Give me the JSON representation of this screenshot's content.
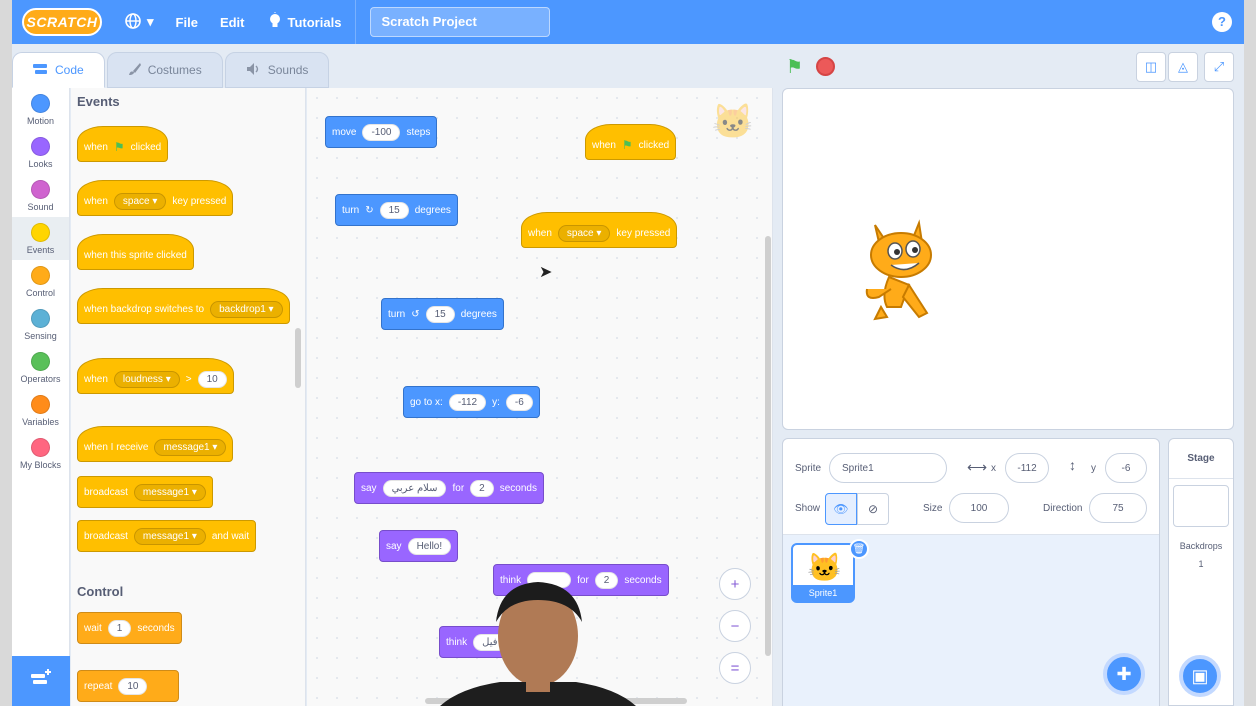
{
  "menubar": {
    "logo": "SCRATCH",
    "globe": "▾",
    "file": "File",
    "edit": "Edit",
    "tutorials": "Tutorials",
    "project_title": "Scratch Project",
    "help": "?"
  },
  "tabs": {
    "code": "Code",
    "costumes": "Costumes",
    "sounds": "Sounds"
  },
  "categories": [
    {
      "label": "Motion",
      "color": "#4c97ff"
    },
    {
      "label": "Looks",
      "color": "#9966ff"
    },
    {
      "label": "Sound",
      "color": "#cf63cf"
    },
    {
      "label": "Events",
      "color": "#ffd500"
    },
    {
      "label": "Control",
      "color": "#ffab19"
    },
    {
      "label": "Sensing",
      "color": "#5cb1d6"
    },
    {
      "label": "Operators",
      "color": "#59c059"
    },
    {
      "label": "Variables",
      "color": "#ff8c1a"
    },
    {
      "label": "My Blocks",
      "color": "#ff6680"
    }
  ],
  "palette": {
    "events_heading": "Events",
    "control_heading": "Control",
    "when_flag": {
      "a": "when",
      "b": "clicked"
    },
    "when_key": {
      "a": "when",
      "key": "space",
      "b": "key pressed"
    },
    "when_sprite_clicked": "when this sprite clicked",
    "when_backdrop": {
      "a": "when backdrop switches to",
      "value": "backdrop1"
    },
    "when_loudness": {
      "a": "when",
      "sel": "loudness",
      "op": ">",
      "value": "10"
    },
    "when_receive": {
      "a": "when I receive",
      "value": "message1"
    },
    "broadcast": {
      "a": "broadcast",
      "value": "message1"
    },
    "broadcast_wait": {
      "a": "broadcast",
      "value": "message1",
      "b": "and wait"
    },
    "wait": {
      "a": "wait",
      "value": "1",
      "b": "seconds"
    },
    "repeat": {
      "a": "repeat",
      "value": "10"
    }
  },
  "scripts": {
    "move": {
      "a": "move",
      "value": "-100",
      "b": "steps"
    },
    "when_flag": {
      "a": "when",
      "b": "clicked"
    },
    "turn_right": {
      "a": "turn",
      "value": "15",
      "b": "degrees"
    },
    "when_key": {
      "a": "when",
      "key": "space",
      "b": "key pressed"
    },
    "turn_left": {
      "a": "turn",
      "value": "15",
      "b": "degrees"
    },
    "goto": {
      "a": "go to x:",
      "x": "-112",
      "b": "y:",
      "y": "-6"
    },
    "say_for": {
      "a": "say",
      "text": "سلام عربي",
      "b": "for",
      "secs": "2",
      "c": "seconds"
    },
    "say": {
      "a": "say",
      "text": "Hello!"
    },
    "think_for": {
      "a": "think",
      "b": "for",
      "secs": "2",
      "c": "seconds"
    },
    "think": {
      "a": "think",
      "text": "فيل"
    }
  },
  "zoom": {
    "in": "+",
    "out": "−",
    "reset": "="
  },
  "sprite_info": {
    "sprite_label": "Sprite",
    "sprite_name": "Sprite1",
    "x_label": "x",
    "x": "-112",
    "y_label": "y",
    "y": "-6",
    "show_label": "Show",
    "size_label": "Size",
    "size": "100",
    "direction_label": "Direction",
    "direction": "75"
  },
  "sprite_list": [
    {
      "name": "Sprite1"
    }
  ],
  "stage_pane": {
    "title": "Stage",
    "backdrops_label": "Backdrops",
    "backdrops_count": "1"
  }
}
